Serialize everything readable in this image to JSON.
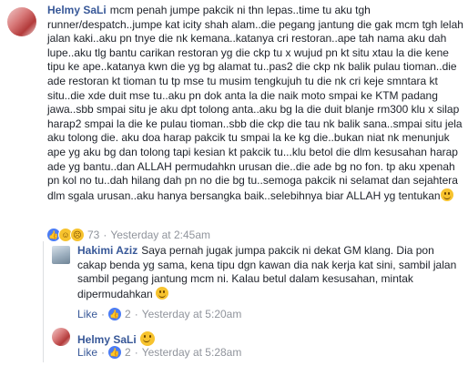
{
  "main_comment": {
    "author": "Helmy SaLi",
    "text": "mcm penah jumpe pakcik ni thn lepas..time tu aku tgh runner/despatch..jumpe kat icity shah alam..die pegang jantung die gak mcm tgh lelah jalan kaki..aku pn tnye die nk kemana..katanya cri restoran..ape tah nama aku dah lupe..aku tlg bantu carikan restoran yg die ckp tu x wujud pn kt situ xtau la die kene tipu ke ape..katanya kwn die yg bg alamat tu..pas2 die ckp nk balik pulau tioman..die ade restoran kt tioman tu tp mse tu musim tengkujuh tu die nk cri keje smntara kt situ..die xde duit mse tu..aku pn dok anta la die naik moto smpai ke KTM padang jawa..sbb smpai situ je aku dpt tolong anta..aku bg la die duit blanje rm300 klu x silap harap2 smpai la die ke pulau tioman..sbb die ckp die tau nk balik sana..smpai situ jela aku tolong die. aku doa harap pakcik tu smpai la ke kg die..bukan niat nk menunjuk ape yg aku bg dan tolong tapi kesian kt pakcik tu...klu betol die dlm kesusahan harap ade yg bantu..dan ALLAH permudahkn urusan die..die ade bg no fon. tp aku xpenah pn kol no tu..dah hilang dah pn no die bg tu..semoga pakcik ni selamat dan sejahtera dlm sgala urusan..aku hanya bersangka baik..selebihnya biar ALLAH yg tentukan",
    "reaction_count": "73",
    "timestamp": "Yesterday at 2:45am",
    "reactions": [
      "like-reaction-icon",
      "haha-reaction-icon",
      "sad-reaction-icon"
    ]
  },
  "reply_hakimi": {
    "author": "Hakimi Aziz",
    "text": "Saya pernah jugak jumpa pakcik ni dekat GM klang. Dia pon cakap benda yg sama, kena tipu dgn kawan dia nak kerja kat sini, sambil jalan sambil pegang jantung mcm ni. Kalau betul dalam kesusahan, mintak dipermudahkan",
    "like_label": "Like",
    "reaction_count": "2",
    "timestamp": "Yesterday at 5:20am"
  },
  "reply_helmy": {
    "author": "Helmy SaLi",
    "like_label": "Like",
    "reaction_count": "2",
    "timestamp": "Yesterday at 5:28am"
  },
  "sep": "·",
  "colors": {
    "link": "#385898",
    "meta": "#90949c",
    "text": "#1d2129"
  }
}
